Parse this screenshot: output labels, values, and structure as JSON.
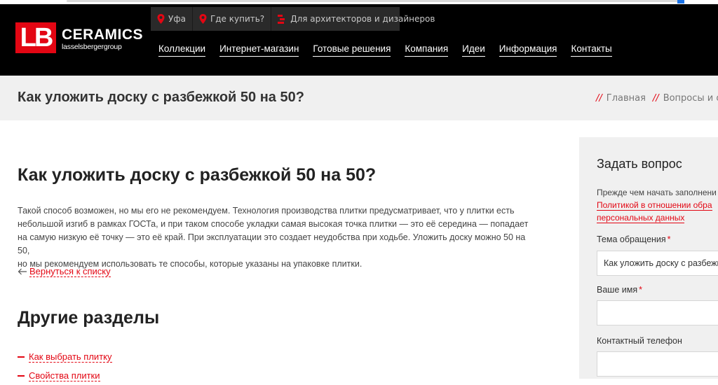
{
  "header": {
    "logo": {
      "mark": "LB",
      "name": "CERAMICS",
      "sub": "lasselsbergergroup"
    },
    "topbar": {
      "city": "Уфа",
      "where_to_buy": "Где купить?",
      "architects": "Для архитекторов и дизайнеров"
    },
    "nav": [
      "Коллекции",
      "Интернет-магазин",
      "Готовые решения",
      "Компания",
      "Идеи",
      "Информация",
      "Контакты"
    ]
  },
  "title_band": {
    "title": "Как уложить доску с разбежкой 50 на 50?",
    "breadcrumb": [
      {
        "sep": "//",
        "label": "Главная"
      },
      {
        "sep": "//",
        "label": "Вопросы и отве"
      }
    ]
  },
  "article": {
    "title": "Как уложить доску с разбежкой 50 на 50?",
    "lines": [
      "Такой способ возможен, но мы его не рекомендуем. Технология производства плитки предусматривает, что у плитки есть",
      "небольшой изгиб в рамках ГОСТа, и при таком способе укладки самая высокая точка плитки — это её середина — попадает",
      "на самую низкую её точку — это её край. При эксплуатации это создает неудобства при ходьбе. Уложить доску можно 50 на 50,",
      "но мы рекомендуем использовать те способы, которые указаны на упаковке плитки."
    ],
    "back_link": "Вернуться к списку"
  },
  "other_sections": {
    "title": "Другие разделы",
    "items": [
      "Как выбрать плитку",
      "Свойства плитки"
    ]
  },
  "form": {
    "title": "Задать вопрос",
    "note_line1": "Прежде чем начать заполнени",
    "note_link1": "Политикой в отношении обра",
    "note_link2": "персональных данных",
    "topic_label": "Тема обращения",
    "topic_value": "Как уложить доску с разбежк",
    "name_label": "Ваше имя",
    "name_value": "",
    "phone_label": "Контактный телефон",
    "phone_value": "",
    "required_mark": "*"
  },
  "colors": {
    "accent": "#e30613",
    "header_bg": "#000000",
    "band_bg": "#f0f0f0"
  }
}
